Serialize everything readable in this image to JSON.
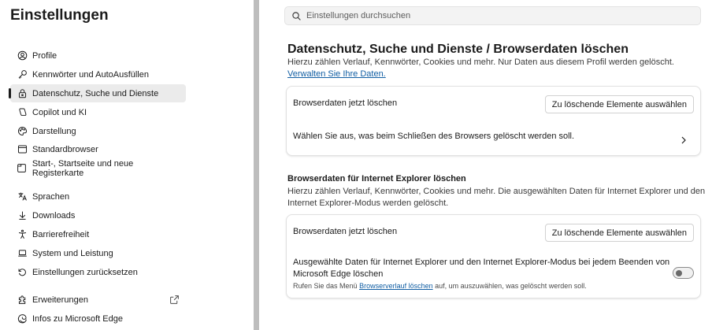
{
  "app": {
    "title": "Einstellungen"
  },
  "sidebar": {
    "items": [
      {
        "label": "Profile",
        "icon": "profile-icon"
      },
      {
        "label": "Kennwörter und AutoAusfüllen",
        "icon": "key-icon"
      },
      {
        "label": "Datenschutz, Suche und Dienste",
        "icon": "lock-icon",
        "active": true
      },
      {
        "label": "Copilot und KI",
        "icon": "copilot-icon"
      },
      {
        "label": "Darstellung",
        "icon": "palette-icon"
      },
      {
        "label": "Standardbrowser",
        "icon": "browser-icon"
      },
      {
        "label": "Start-, Startseite und neue Registerkarte",
        "icon": "home-tab-icon"
      },
      {
        "label": "Sprachen",
        "icon": "language-icon"
      },
      {
        "label": "Downloads",
        "icon": "download-icon"
      },
      {
        "label": "Barrierefreiheit",
        "icon": "accessibility-icon"
      },
      {
        "label": "System und Leistung",
        "icon": "laptop-icon"
      },
      {
        "label": "Einstellungen zurücksetzen",
        "icon": "reset-icon"
      },
      {
        "label": "Erweiterungen",
        "icon": "extensions-icon",
        "external": true
      },
      {
        "label": "Infos zu Microsoft Edge",
        "icon": "edge-icon"
      }
    ]
  },
  "search": {
    "placeholder": "Einstellungen durchsuchen"
  },
  "main": {
    "title": "Datenschutz, Suche und Dienste / Browserdaten löschen",
    "description": "Hierzu zählen Verlauf, Kennwörter, Cookies und mehr. Nur Daten aus diesem Profil werden gelöscht.",
    "manage_link": "Verwalten Sie Ihre Daten.",
    "card1": {
      "row1_label": "Browserdaten jetzt löschen",
      "row1_button": "Zu löschende Elemente auswählen",
      "row2_label": "Wählen Sie aus, was beim Schließen des Browsers gelöscht werden soll."
    },
    "ie_section": {
      "title": "Browserdaten für Internet Explorer löschen",
      "description_line1": "Hierzu zählen Verlauf, Kennwörter, Cookies und mehr. Die ausgewählten Daten für Internet Explorer und den",
      "description_line2": "Internet Explorer-Modus werden gelöscht.",
      "row1_label": "Browserdaten jetzt löschen",
      "row1_button": "Zu löschende Elemente auswählen",
      "row2_label_line1": "Ausgewählte Daten für Internet Explorer und den Internet Explorer-Modus bei jedem Beenden von",
      "row2_label_line2": "Microsoft Edge löschen",
      "toggle_on": false,
      "note_prefix": "Rufen Sie das Menü",
      "note_link": "Browserverlauf löschen",
      "note_suffix": "auf, um auszuwählen, was gelöscht werden soll."
    }
  },
  "colors": {
    "accent_link": "#115ea3",
    "active_bg": "#ebebeb",
    "divider": "#bdbdbd"
  }
}
